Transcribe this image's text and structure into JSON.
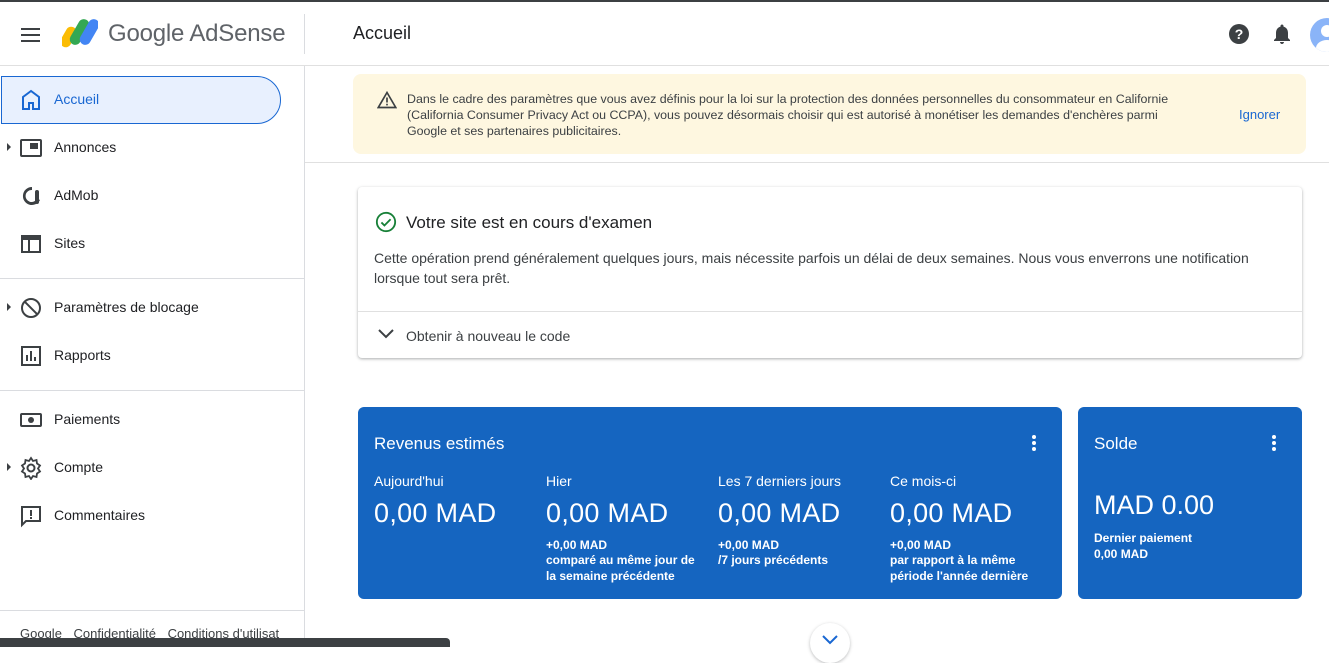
{
  "header": {
    "brand": "Google AdSense",
    "title": "Accueil",
    "menu_icon": "hamburger-menu-icon",
    "help_icon": "help-icon",
    "notification_icon": "bell-icon"
  },
  "sidebar": {
    "items": [
      {
        "label": "Accueil",
        "icon": "home-icon",
        "active": true
      },
      {
        "label": "Annonces",
        "icon": "ads-icon",
        "expandable": true
      },
      {
        "label": "AdMob",
        "icon": "admob-icon"
      },
      {
        "label": "Sites",
        "icon": "sites-icon"
      },
      {
        "label": "Paramètres de blocage",
        "icon": "block-icon",
        "expandable": true
      },
      {
        "label": "Rapports",
        "icon": "reports-icon"
      },
      {
        "label": "Paiements",
        "icon": "payments-icon"
      },
      {
        "label": "Compte",
        "icon": "gear-icon",
        "expandable": true
      },
      {
        "label": "Commentaires",
        "icon": "feedback-icon"
      }
    ],
    "footer": [
      "Google",
      "Confidentialité",
      "Conditions d'utilisat"
    ]
  },
  "banner": {
    "text": "Dans le cadre des paramètres que vous avez définis pour la loi sur la protection des données personnelles du consommateur en Californie (California Consumer Privacy Act ou CCPA), vous pouvez désormais choisir qui est autorisé à monétiser les demandes d'enchères parmi Google et ses partenaires publicitaires.",
    "action": "Ignorer",
    "color": "#fef7e0"
  },
  "review": {
    "title": "Votre site est en cours d'examen",
    "text": "Cette opération prend généralement quelques jours, mais nécessite parfois un délai de deux semaines. Nous vous enverrons une notification lorsque tout sera prêt.",
    "code_link": "Obtenir à nouveau le code"
  },
  "revenue": {
    "title": "Revenus estimés",
    "color": "#1565c0",
    "metrics": [
      {
        "label": "Aujourd'hui",
        "value": "0,00 MAD",
        "delta": "",
        "comparison": ""
      },
      {
        "label": "Hier",
        "value": "0,00 MAD",
        "delta": "+0,00 MAD",
        "comparison": "comparé au même jour de la semaine précédente"
      },
      {
        "label": "Les 7 derniers jours",
        "value": "0,00 MAD",
        "delta": "+0,00 MAD",
        "comparison": "/7 jours précédents"
      },
      {
        "label": "Ce mois-ci",
        "value": "0,00 MAD",
        "delta": "+0,00 MAD",
        "comparison": "par rapport à la même période l'année dernière"
      }
    ]
  },
  "balance": {
    "title": "Solde",
    "value": "MAD 0.00",
    "last_payment_label": "Dernier paiement",
    "last_payment_value": "0,00 MAD"
  }
}
